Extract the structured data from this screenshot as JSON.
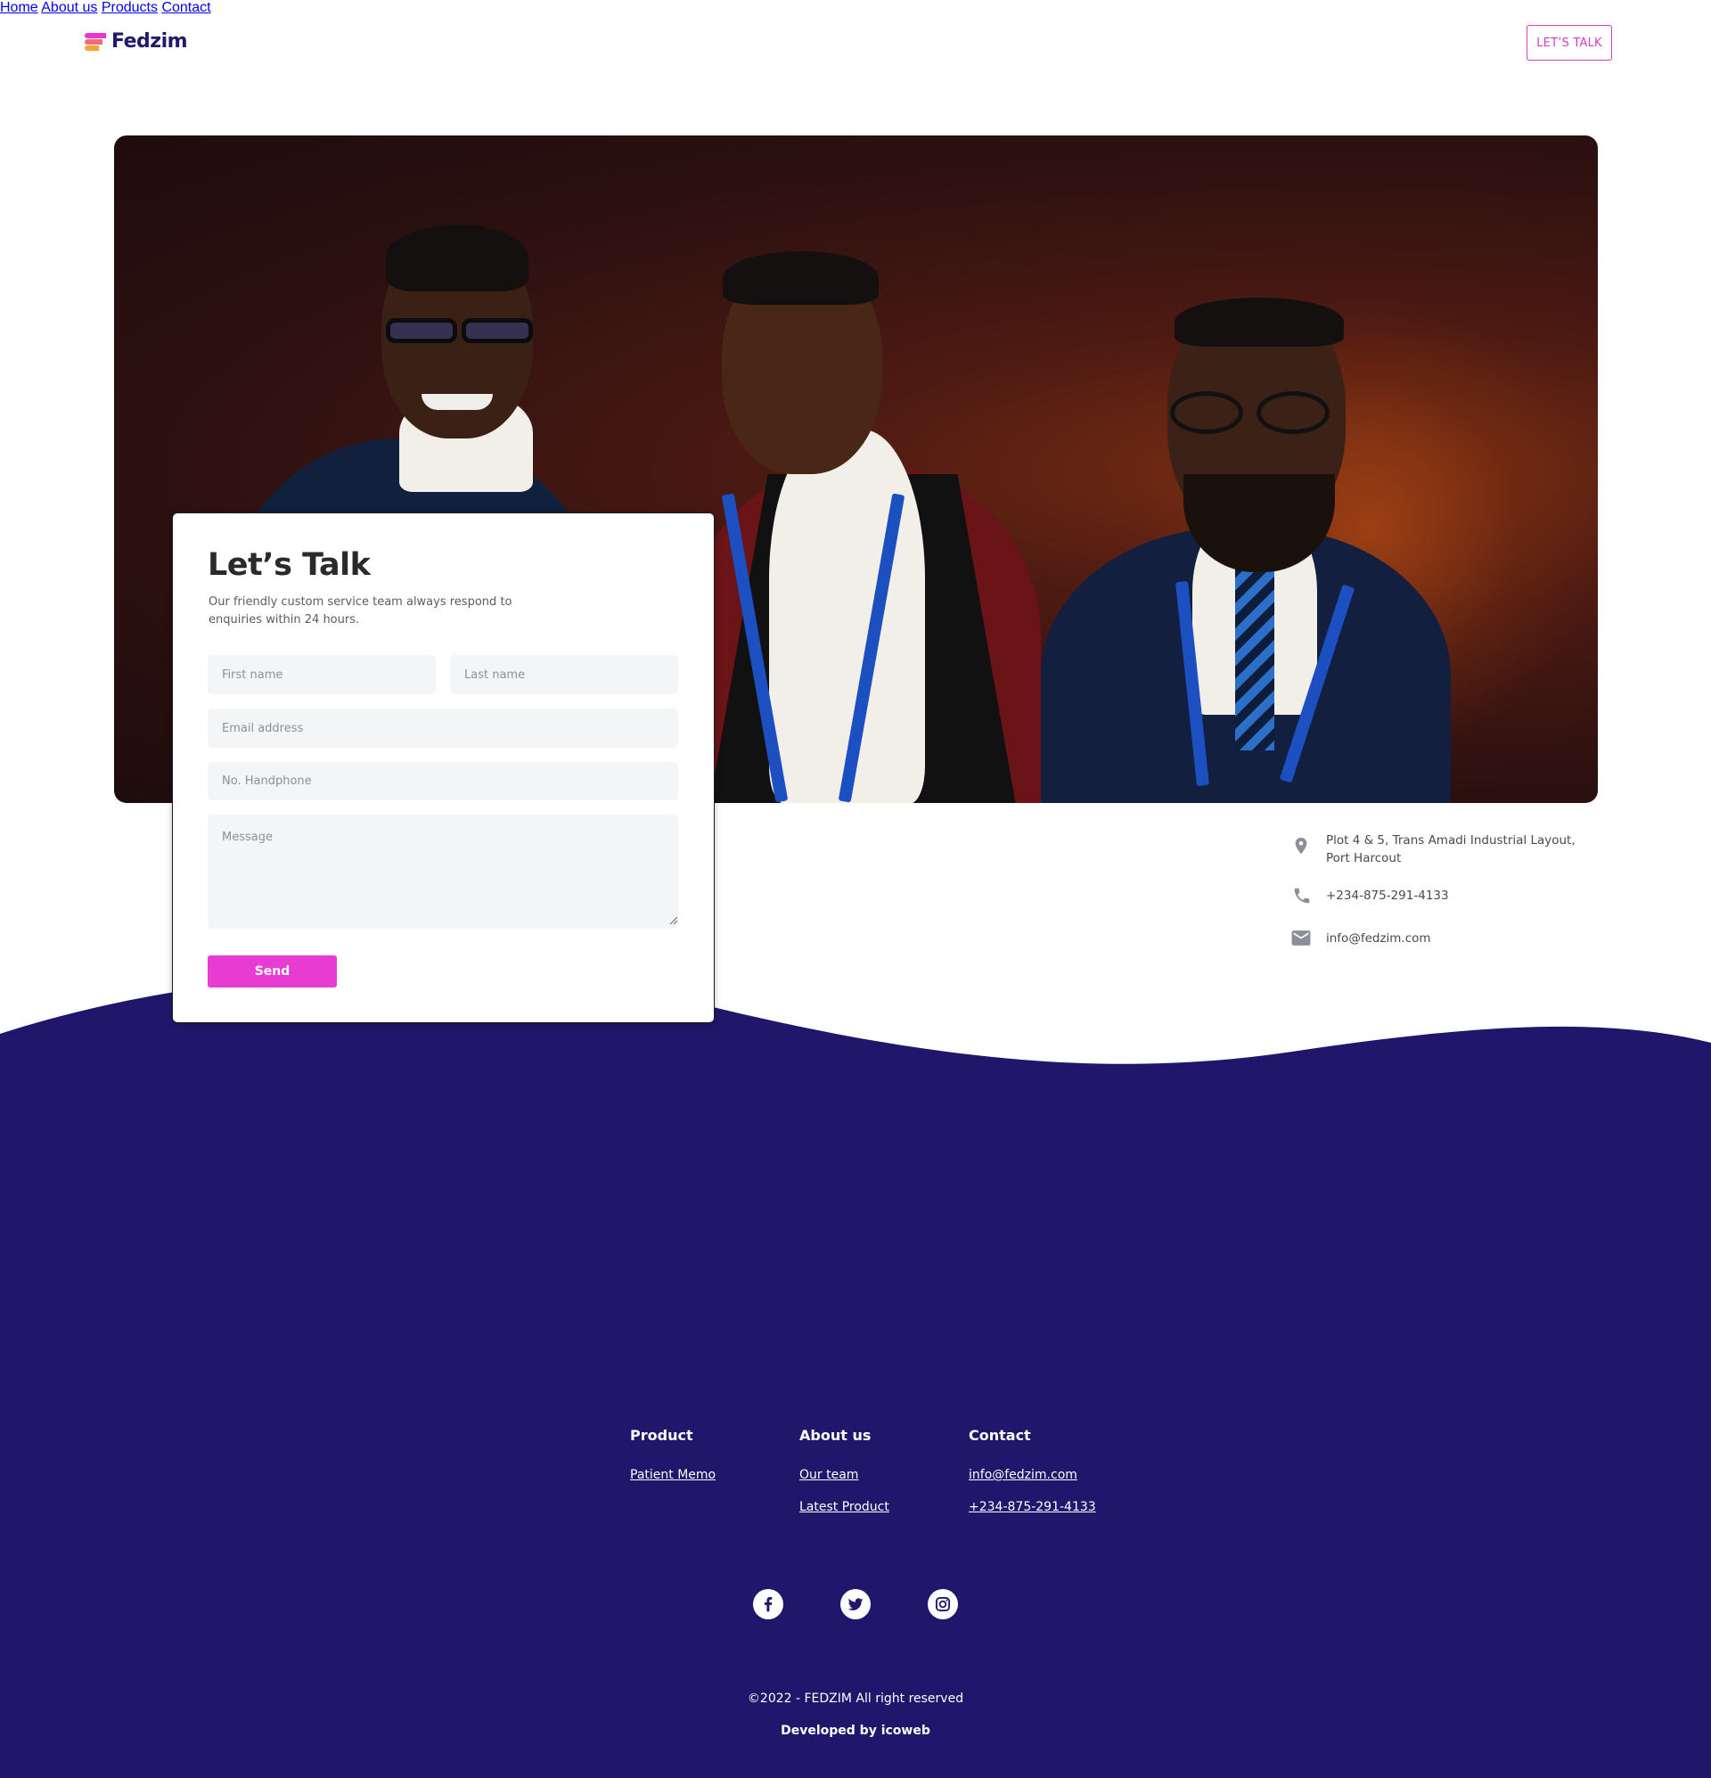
{
  "header": {
    "brand": "Fedzim",
    "nav": [
      "Home",
      "About us",
      "Products",
      "Contact"
    ],
    "cta": "LET’S TALK"
  },
  "form": {
    "title": "Let’s Talk",
    "subtitle": "Our friendly custom service team always respond to enquiries within 24 hours.",
    "first_name_placeholder": "First name",
    "last_name_placeholder": "Last name",
    "email_placeholder": "Email address",
    "phone_placeholder": "No. Handphone",
    "message_placeholder": "Message",
    "send": "Send"
  },
  "contact_info": {
    "address": "Plot 4 & 5, Trans Amadi Industrial Layout, Port Harcout",
    "phone": "+234-875-291-4133",
    "email": "info@fedzim.com"
  },
  "footer": {
    "columns": [
      {
        "heading": "Product",
        "links": [
          "Patient Memo"
        ]
      },
      {
        "heading": "About us",
        "links": [
          "Our team",
          "Latest Product"
        ]
      },
      {
        "heading": "Contact",
        "links": [
          "info@fedzim.com",
          "+234-875-291-4133"
        ]
      }
    ],
    "social": [
      "facebook-icon",
      "twitter-icon",
      "instagram-icon"
    ],
    "copyright": "©2022 - FEDZIM All right reserved",
    "developed_by": "Developed by icoweb"
  },
  "colors": {
    "brand_navy": "#1f1a6b",
    "accent_pink": "#e83bd2",
    "footer_bg": "#20176c"
  }
}
